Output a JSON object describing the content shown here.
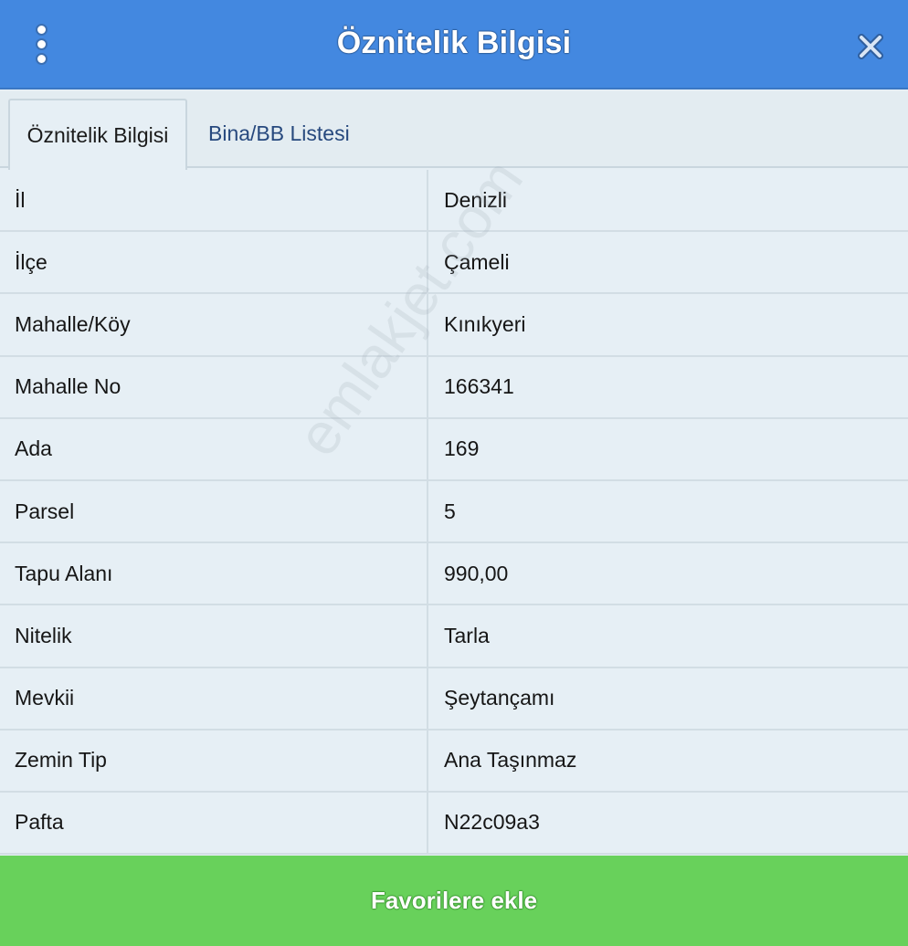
{
  "header": {
    "title": "Öznitelik Bilgisi",
    "menu_icon": "kebab-menu-icon",
    "close_icon": "close-icon"
  },
  "tabs": [
    {
      "label": "Öznitelik Bilgisi",
      "active": true
    },
    {
      "label": "Bina/BB Listesi",
      "active": false
    }
  ],
  "attributes": [
    {
      "label": "İl",
      "value": "Denizli"
    },
    {
      "label": "İlçe",
      "value": "Çameli"
    },
    {
      "label": "Mahalle/Köy",
      "value": "Kınıkyeri"
    },
    {
      "label": "Mahalle No",
      "value": "166341"
    },
    {
      "label": "Ada",
      "value": "169"
    },
    {
      "label": "Parsel",
      "value": "5"
    },
    {
      "label": "Tapu Alanı",
      "value": "990,00"
    },
    {
      "label": "Nitelik",
      "value": "Tarla"
    },
    {
      "label": "Mevkii",
      "value": "Şeytançamı"
    },
    {
      "label": "Zemin Tip",
      "value": "Ana Taşınmaz"
    },
    {
      "label": "Pafta",
      "value": "N22c09a3"
    }
  ],
  "footer": {
    "button_label": "Favorilere ekle"
  },
  "watermark": "emlakjet.com",
  "colors": {
    "header_bg": "#4388e0",
    "tab_link": "#27497e",
    "footer_bg": "#68d15b",
    "table_bg": "#e6eff5"
  }
}
